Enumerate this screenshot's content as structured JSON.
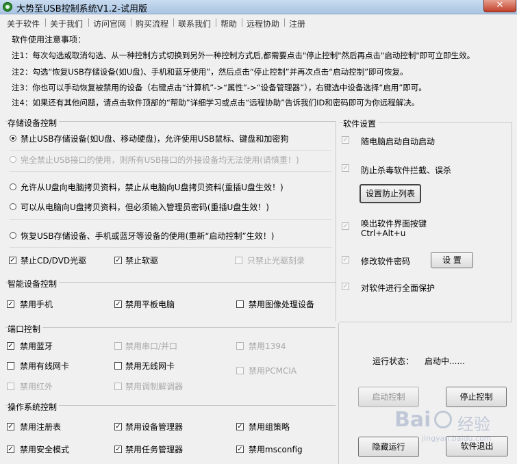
{
  "window": {
    "title": "大势至USB控制系统V1.2-试用版",
    "close_glyph": "✕"
  },
  "menu": [
    "关于软件",
    "关于我们",
    "访问官网",
    "购买流程",
    "联系我们",
    "帮助",
    "远程协助",
    "注册"
  ],
  "notes": {
    "heading": "软件使用注意事项：",
    "items": [
      "注1：每次勾选或取消勾选、从一种控制方式切换到另外一种控制方式后,都需要点击\"停止控制\"然后再点击\"启动控制\"即可立即生效。",
      "注2：勾选“恢复USB存储设备(如U盘)、手机和蓝牙使用”，然后点击“停止控制”并再次点击“启动控制”即可恢复。",
      "注3：你也可以手动恢复被禁用的设备（右键点击“计算机”->“属性”->“设备管理器”），右键选中设备选择“启用”即可。",
      "注4：如果还有其他问题，请点击软件顶部的“帮助”详细学习或点击“远程协助”告诉我们ID和密码即可为你远程解决。"
    ]
  },
  "storage": {
    "title": "存储设备控制",
    "radios": [
      "禁止USB存储设备(如U盘、移动硬盘)，允许使用USB鼠标、键盘和加密狗",
      "完全禁止USB接口的使用，则所有USB接口的外接设备均无法使用(请慎重！)",
      "允许从U盘向电脑拷贝资料，禁止从电脑向U盘拷贝资料(重插U盘生效！)",
      "可以从电脑向U盘拷贝资料，但必须输入管理员密码(重插U盘生效！)",
      "恢复USB存储设备、手机或蓝牙等设备的使用(重新“启动控制”生效！)"
    ],
    "checks": [
      "禁止CD/DVD光驱",
      "禁止软驱",
      "只禁止光驱刻录"
    ]
  },
  "smart": {
    "title": "智能设备控制",
    "checks": [
      "禁用手机",
      "禁用平板电脑",
      "禁用图像处理设备"
    ]
  },
  "ports": {
    "title": "端口控制",
    "checks": [
      "禁用蓝牙",
      "禁用串口/并口",
      "禁用1394",
      "禁用有线网卡",
      "禁用无线网卡",
      "禁用PCMCIA",
      "禁用红外",
      "禁用调制解调器"
    ]
  },
  "os": {
    "title": "操作系统控制",
    "checks": [
      "禁用注册表",
      "禁用设备管理器",
      "禁用组策略",
      "禁用安全模式",
      "禁用任务管理器",
      "禁用msconfig"
    ]
  },
  "settings": {
    "title": "软件设置",
    "autostart": "随电脑启动自动启动",
    "antikill": "防止杀毒软件拦截、误杀",
    "set_list_button": "设置防止列表",
    "hotkey_line1": "唤出软件界面按键",
    "hotkey_line2": "Ctrl+Alt+u",
    "password": "修改软件密码",
    "password_button": "设 置",
    "protect": "对软件进行全面保护"
  },
  "status": {
    "label": "运行状态：",
    "value": "启动中......"
  },
  "buttons": {
    "start": "启动控制",
    "stop": "停止控制",
    "hide": "隐藏运行",
    "exit": "软件退出"
  },
  "watermark": {
    "brand": "Bai",
    "brand2": "经验",
    "url": "jingyan.baidu.com"
  },
  "colors": {
    "titlebar": "#b8cfe8",
    "close": "#c8432e",
    "disabled_text": "#a8a8a8",
    "background": "#f0f0f0"
  }
}
